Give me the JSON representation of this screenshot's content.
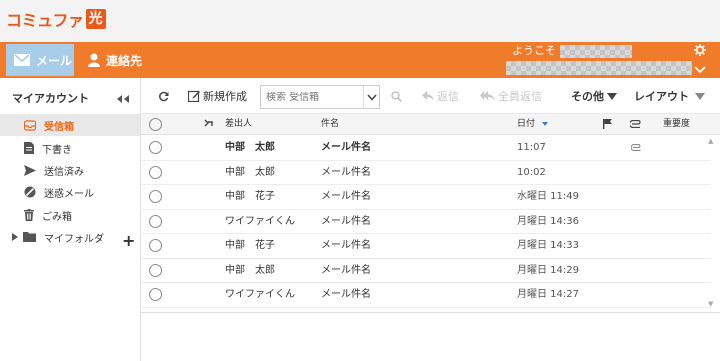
{
  "brand": {
    "logo_text": "コミュファ",
    "logo_box": "光",
    "accent": "#f07b2a",
    "mail_tab_bg": "#a8cde8"
  },
  "nav": {
    "mail_label": "メール",
    "contacts_label": "連絡先",
    "welcome": "ようこそ"
  },
  "sidebar": {
    "title": "マイアカウント",
    "items": [
      {
        "label": "受信箱",
        "icon": "inbox-icon",
        "active": true
      },
      {
        "label": "下書き",
        "icon": "draft-icon"
      },
      {
        "label": "送信済み",
        "icon": "sent-icon"
      },
      {
        "label": "迷惑メール",
        "icon": "spam-icon"
      },
      {
        "label": "ごみ箱",
        "icon": "trash-icon"
      },
      {
        "label": "マイフォルダ",
        "icon": "folder-icon"
      }
    ]
  },
  "toolbar": {
    "new_label": "新規作成",
    "search_placeholder": "検索 受信箱",
    "reply_label": "返信",
    "reply_all_label": "全員返信",
    "other_label": "その他",
    "layout_label": "レイアウト"
  },
  "columns": {
    "sender": "差出人",
    "subject": "件名",
    "date": "日付",
    "importance": "重要度"
  },
  "rows": [
    {
      "sender": "中部　太郎",
      "subject": "メール件名",
      "date": "11:07",
      "unread": true,
      "attachment": true
    },
    {
      "sender": "中部　太郎",
      "subject": "メール件名",
      "date": "10:02"
    },
    {
      "sender": "中部　花子",
      "subject": "メール件名",
      "date": "水曜日 11:49"
    },
    {
      "sender": "ワイファイくん",
      "subject": "メール件名",
      "date": "月曜日 14:36"
    },
    {
      "sender": "中部　花子",
      "subject": "メール件名",
      "date": "月曜日 14:33"
    },
    {
      "sender": "中部　太郎",
      "subject": "メール件名",
      "date": "月曜日 14:29"
    },
    {
      "sender": "ワイファイくん",
      "subject": "メール件名",
      "date": "月曜日 14:27"
    }
  ]
}
